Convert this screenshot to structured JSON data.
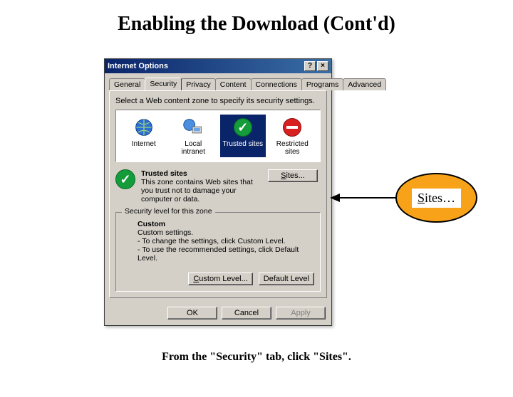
{
  "slide": {
    "title": "Enabling the Download (Cont'd)",
    "caption": "From the \"Security\" tab, click \"Sites\"."
  },
  "callout": {
    "label": "Sites…"
  },
  "dialog": {
    "title": "Internet Options",
    "help_btn": "?",
    "close_btn": "×",
    "tabs": [
      "General",
      "Security",
      "Privacy",
      "Content",
      "Connections",
      "Programs",
      "Advanced"
    ],
    "active_tab_index": 1,
    "instruction": "Select a Web content zone to specify its security settings.",
    "zones": [
      {
        "label": "Internet"
      },
      {
        "label": "Local intranet"
      },
      {
        "label": "Trusted sites"
      },
      {
        "label": "Restricted sites"
      }
    ],
    "selected_zone_index": 2,
    "trusted": {
      "heading": "Trusted sites",
      "body": "This zone contains Web sites that you trust not to damage your computer or data."
    },
    "sites_btn": "Sites...",
    "group_label": "Security level for this zone",
    "custom": {
      "heading": "Custom",
      "line1": "Custom settings.",
      "line2": "- To change the settings, click Custom Level.",
      "line3": "- To use the recommended settings, click Default Level."
    },
    "custom_level_btn": "Custom Level...",
    "default_level_btn": "Default Level",
    "ok_btn": "OK",
    "cancel_btn": "Cancel",
    "apply_btn": "Apply"
  }
}
